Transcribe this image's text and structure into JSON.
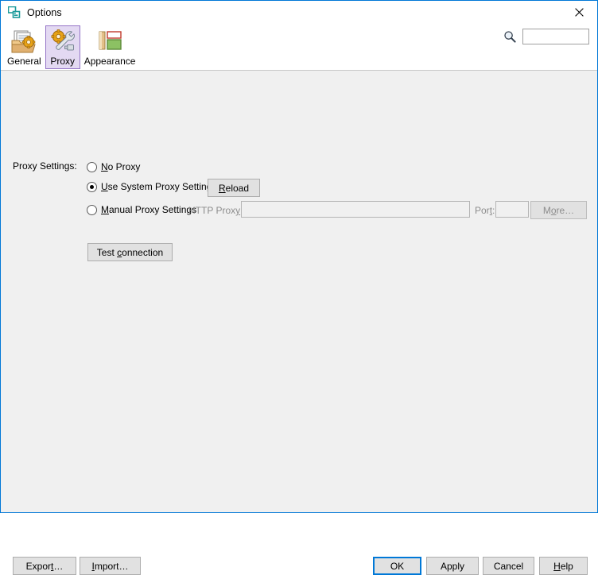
{
  "window": {
    "title": "Options",
    "icon": "options-windows-icon",
    "close_icon": "close-icon",
    "border_color": "#0078d7",
    "background": "#f0f0f0"
  },
  "toolbar": {
    "tabs": [
      {
        "label": "General",
        "icon": "documents-gear-icon",
        "selected": false
      },
      {
        "label": "Proxy",
        "icon": "gear-wrench-icon",
        "selected": true
      },
      {
        "label": "Appearance",
        "icon": "layout-panels-icon",
        "selected": false
      }
    ],
    "selected_tab_bg": "#e3d9f2",
    "selected_tab_border": "#9575c7",
    "search": {
      "icon": "search-icon",
      "value": "",
      "placeholder": ""
    }
  },
  "main": {
    "group_label": "Proxy Settings:",
    "options": [
      {
        "label": "No Proxy",
        "mnemonic": "N",
        "selected": false
      },
      {
        "label": "Use System Proxy Settings",
        "mnemonic": "U",
        "selected": true
      },
      {
        "label": "Manual Proxy Settings",
        "mnemonic": "M",
        "selected": false
      }
    ],
    "reload_button": "Reload",
    "http_proxy_label": "HTTP Proxy:",
    "http_proxy_value": "",
    "http_proxy_enabled": false,
    "port_label": "Port:",
    "port_value": "",
    "port_enabled": false,
    "more_button": "More…",
    "more_enabled": false,
    "test_connection_button": "Test connection"
  },
  "footer": {
    "export_button": "Export…",
    "import_button": "Import…",
    "ok_button": "OK",
    "apply_button": "Apply",
    "cancel_button": "Cancel",
    "help_button": "Help",
    "default_button": "OK",
    "default_highlight": "#0078d7"
  }
}
